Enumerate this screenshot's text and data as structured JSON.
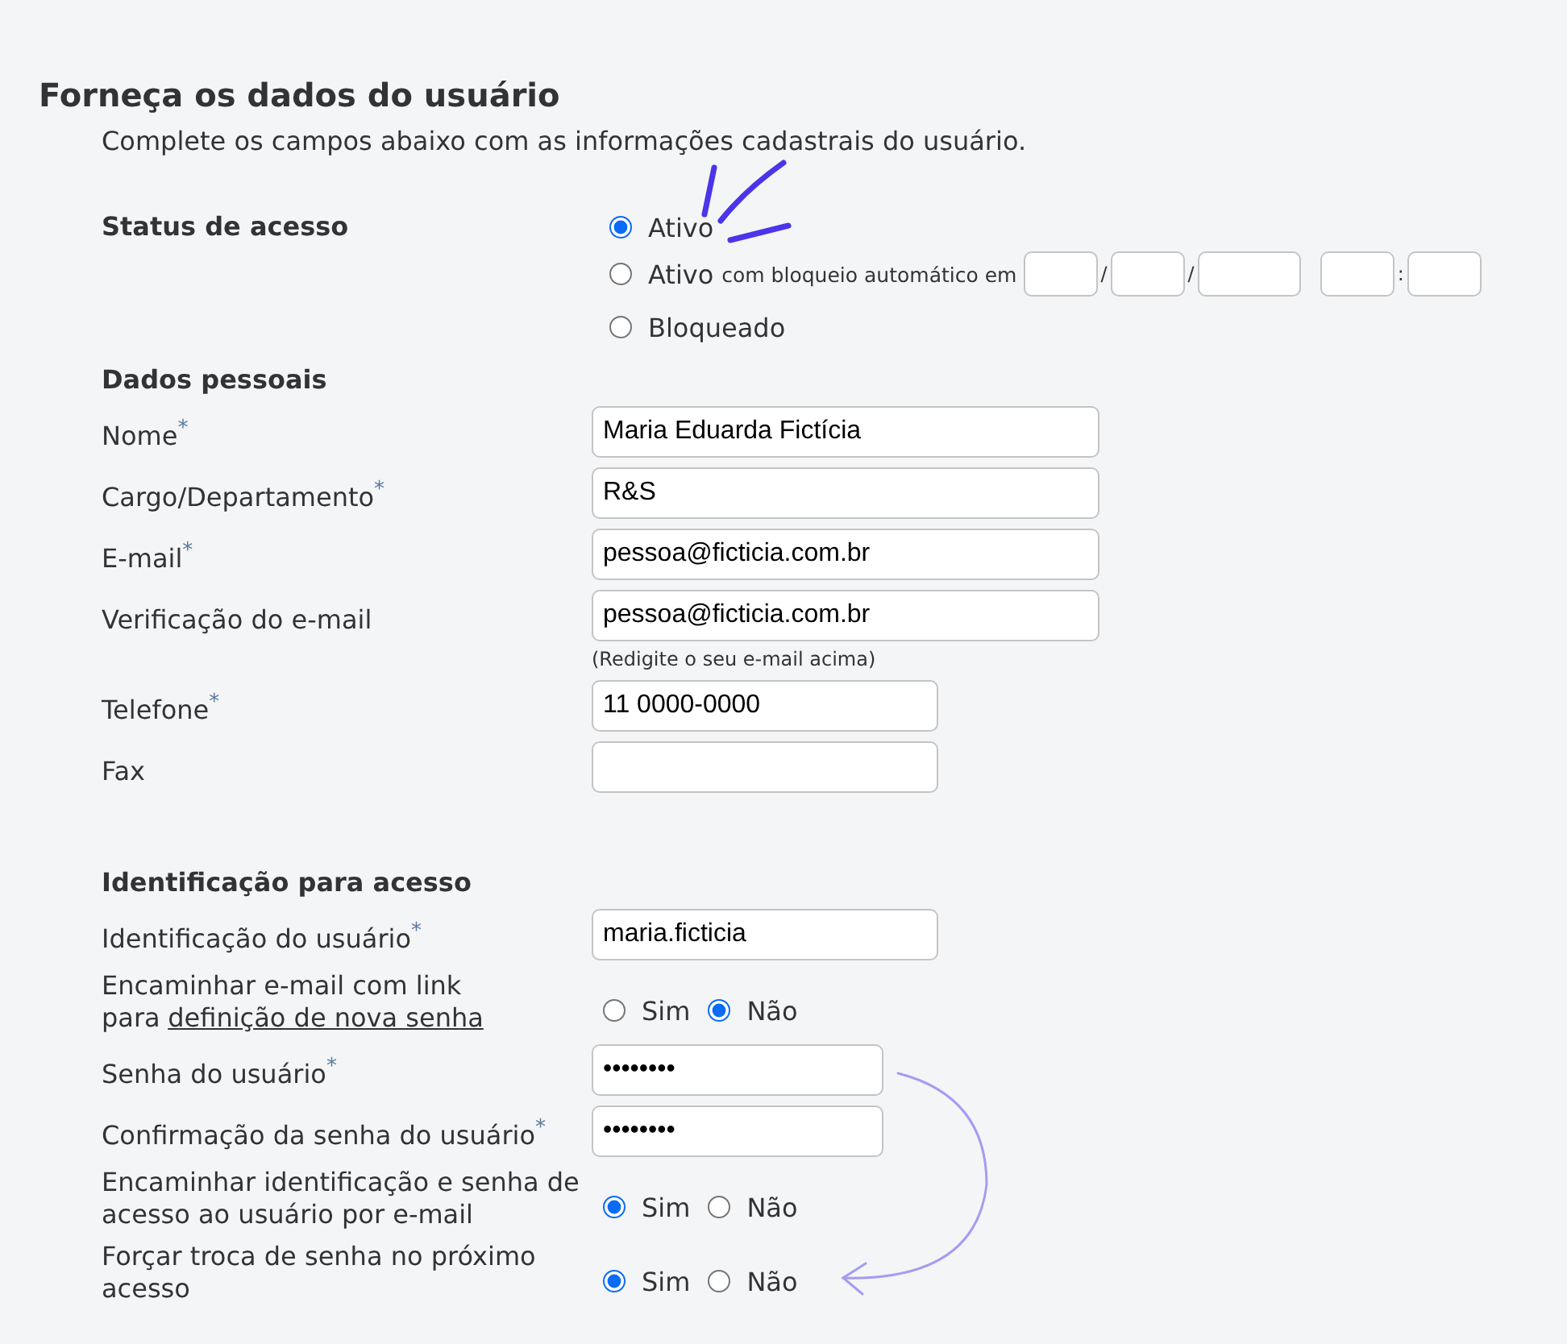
{
  "title": "Forneça os dados do usuário",
  "subtitle": "Complete os campos abaixo com as informações cadastrais do usuário.",
  "status": {
    "label": "Status de acesso",
    "options": [
      {
        "label": "Ativo",
        "selected": true
      },
      {
        "label": "Ativo",
        "selected": false,
        "note": "com bloqueio automático em",
        "datetime": [
          {
            "kind": "field"
          },
          {
            "kind": "sep",
            "text": "/"
          },
          {
            "kind": "field"
          },
          {
            "kind": "sep",
            "text": "/"
          },
          {
            "kind": "wide-field"
          },
          {
            "kind": "space"
          },
          {
            "kind": "field"
          },
          {
            "kind": "sep",
            "text": ":"
          },
          {
            "kind": "field"
          }
        ]
      },
      {
        "label": "Bloqueado",
        "selected": false
      }
    ]
  },
  "personal": {
    "heading": "Dados pessoais",
    "fields": [
      {
        "kind": "wide",
        "label": "Nome$^{*}$",
        "value": "Maria Eduarda Fictícia"
      },
      {
        "kind": "wide",
        "label": "Cargo/Departamento$^{*}$",
        "value": "R&S"
      },
      {
        "kind": "wide",
        "label": "E-mail$^{*}$",
        "value": "pessoa@ficticia.com.br"
      },
      {
        "kind": "wide",
        "label": "Verificação do e-mail",
        "value": "pessoa@ficticia.com.br",
        "hint": "(Redigite o seu e-mail acima)"
      },
      {
        "kind": "narrow",
        "label": "Telefone$^{*}$",
        "value": "11 0000-0000"
      },
      {
        "kind": "narrow",
        "label": "Fax"
      }
    ]
  },
  "access": {
    "heading": "Identificação para acesso",
    "rows": [
      {
        "kind": "input",
        "label": "Identificação do usuário$^{*}$",
        "value": "maria.ficticia"
      },
      {
        "kind": "choice",
        "label": "Encaminhar e-mail com link para",
        "link": "definição de nova senha",
        "options": [
          {
            "label": "Sim",
            "selected": false
          },
          {
            "label": "Não",
            "selected": true
          }
        ]
      },
      {
        "kind": "password",
        "label": "Senha do usuário$^{*}$",
        "value": "••••••••"
      },
      {
        "kind": "password",
        "label": "Confirmação da senha do usuário$^{*}$",
        "value": "••••••••"
      },
      {
        "kind": "choice",
        "label": "Encaminhar identificação e senha de acesso ao usuário por e-mail",
        "options": [
          {
            "label": "Sim",
            "selected": true
          },
          {
            "label": "Não",
            "selected": false
          }
        ]
      },
      {
        "kind": "choice",
        "label": "Forçar troca de senha no próximo acesso",
        "options": [
          {
            "label": "Sim",
            "selected": true
          },
          {
            "label": "Não",
            "selected": false
          }
        ]
      }
    ]
  }
}
